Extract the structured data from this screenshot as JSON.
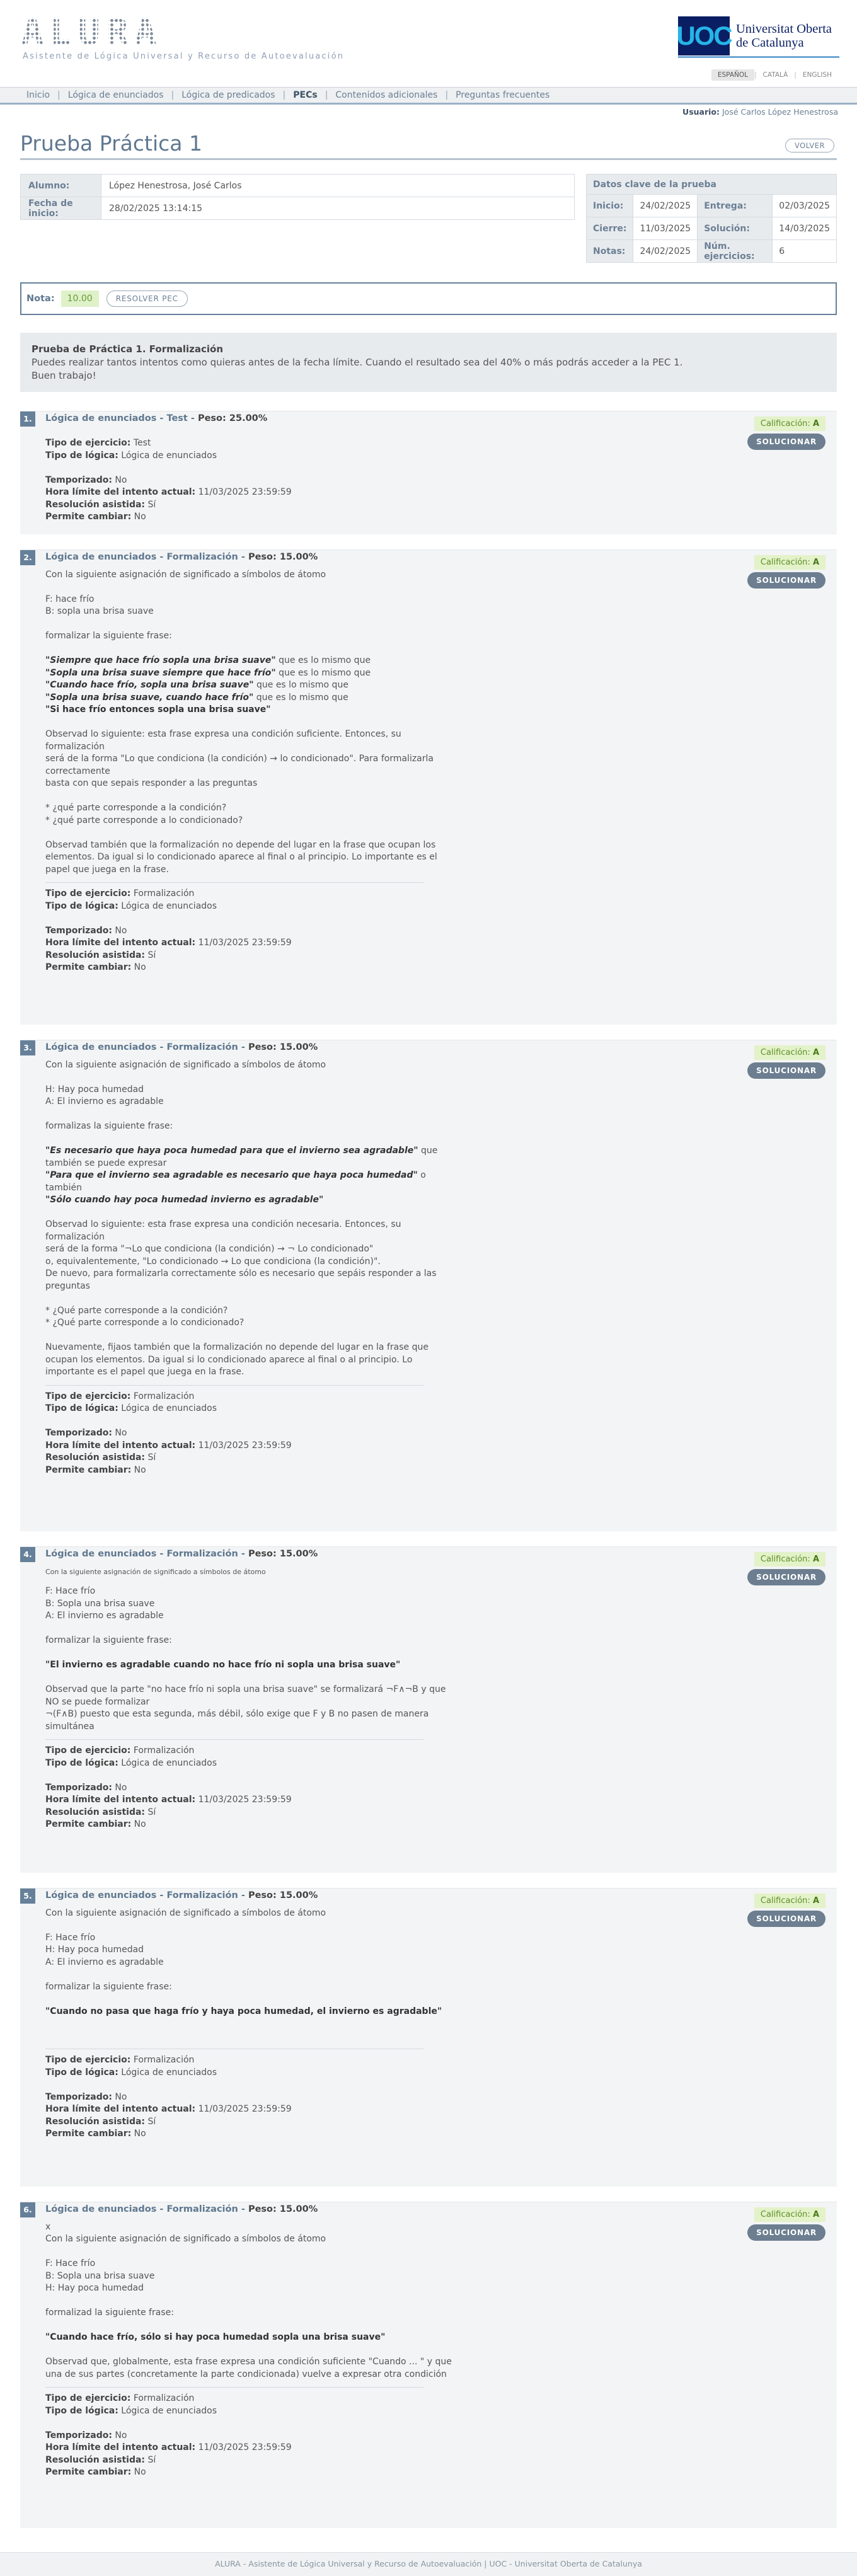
{
  "header": {
    "logo": "ALURA",
    "subtitle": "Asistente de Lógica Universal y Recurso de Autoevaluación",
    "uoc_mark": "UOC",
    "uoc_name_line1": "Universitat Oberta",
    "uoc_name_line2": "de Catalunya"
  },
  "lang": {
    "es": "ESPAÑOL",
    "ca": "CATALÀ",
    "en": "ENGLISH"
  },
  "nav": {
    "items": [
      "Inicio",
      "Lógica de enunciados",
      "Lógica de predicados",
      "PECs",
      "Contenidos adicionales",
      "Preguntas frecuentes"
    ],
    "active_index": 3
  },
  "user": {
    "label": "Usuario:",
    "name": "José Carlos López Henestrosa"
  },
  "page": {
    "title": "Prueba Práctica 1",
    "volver": "VOLVER"
  },
  "student": {
    "alumno_label": "Alumno:",
    "alumno": "López Henestrosa, José Carlos",
    "inicio_label": "Fecha de inicio:",
    "inicio": "28/02/2025 13:14:15"
  },
  "keyfacts": {
    "title": "Datos clave de la prueba",
    "inicio_label": "Inicio:",
    "inicio": "24/02/2025",
    "entrega_label": "Entrega:",
    "entrega": "02/03/2025",
    "cierre_label": "Cierre:",
    "cierre": "11/03/2025",
    "solucion_label": "Solución:",
    "solucion": "14/03/2025",
    "notas_label": "Notas:",
    "notas": "24/02/2025",
    "num_label": "Núm. ejercicios:",
    "num": "6"
  },
  "nota": {
    "label": "Nota:",
    "value": "10.00",
    "resolver": "RESOLVER PEC"
  },
  "intro": {
    "title": "Prueba de Práctica 1. Formalización",
    "line1": "Puedes realizar tantos intentos como quieras antes de la fecha límite. Cuando el resultado sea del 40% o más podrás acceder a la PEC 1.",
    "line2": "Buen trabajo!"
  },
  "common": {
    "calif_label": "Calificación:",
    "calif_value": "A",
    "solucionar": "SOLUCIONAR",
    "tipo_ejercicio_label": "Tipo de ejercicio:",
    "tipo_logica_label": "Tipo de lógica:",
    "temporizado_label": "Temporizado:",
    "hora_limite_label": "Hora límite del intento actual:",
    "resolucion_label": "Resolución asistida:",
    "permite_label": "Permite cambiar:",
    "logica": "Lógica de enunciados",
    "temporizado": "No",
    "hora_limite": "11/03/2025 23:59:59",
    "resolucion": "Sí",
    "permite": "No",
    "peso_label": "Peso:"
  },
  "q1": {
    "num": "1.",
    "title": "Lógica de enunciados - Test",
    "peso": "25.00%",
    "tipo": "Test"
  },
  "q2": {
    "num": "2.",
    "title": "Lógica de enunciados - Formalización",
    "peso": "15.00%",
    "tipo": "Formalización",
    "intro": "Con la siguiente asignación de significado a símbolos de átomo",
    "a1": "F: hace frío",
    "a2": "B: sopla una brisa suave",
    "formalizar": "formalizar la siguiente frase:",
    "s1": "\"Siempre que hace frío sopla una brisa suave\"",
    "s1r": "  que es lo mismo que",
    "s2": "\"Sopla una brisa suave siempre que hace frío\"",
    "s2r": " que es lo mismo que",
    "s3": "\"Cuando hace frío, sopla una brisa suave\"",
    "s3r": " que es lo mismo que",
    "s4": "\"Sopla una brisa suave, cuando hace frío\"",
    "s4r": " que es lo mismo que",
    "s5": "\"Si hace frío entonces sopla una brisa suave\"",
    "obs1": "Observad lo siguiente: esta frase expresa una condición suficiente. Entonces, su formalización",
    "obs2": "será de la forma \"Lo que condiciona (la condición) → lo condicionado\". Para formalizarla  correctamente",
    "obs3": "basta con que sepais responder a las preguntas",
    "p1": "* ¿qué parte corresponde a la condición?",
    "p2": "* ¿qué parte corresponde a lo condicionado?",
    "obs4": "Observad también que la formalización no depende del lugar en la frase que ocupan los elementos. Da igual si lo condicionado aparece al final o al principio. Lo importante es el papel que juega en la frase."
  },
  "q3": {
    "num": "3.",
    "title": "Lógica de enunciados - Formalización",
    "peso": "15.00%",
    "tipo": "Formalización",
    "intro": "Con la siguiente asignación de significado a símbolos de átomo",
    "a1": "H: Hay poca humedad",
    "a2": "A: El invierno es agradable",
    "formalizar": "formalizas la siguiente frase:",
    "s1": "\"Es necesario que haya poca humedad para que el invierno sea agradable\"",
    "s1r": " que",
    "s1r2": "también se puede expresar",
    "s2": "\"Para que el invierno sea agradable es necesario que haya poca humedad\"",
    "s2r": " o",
    "s2r2": "también",
    "s3": "\"Sólo cuando hay poca humedad invierno es agradable\"",
    "obs1": "Observad lo siguiente: esta frase expresa una condición necesaria. Entonces, su formalización",
    "obs2": "será de la forma \"¬Lo que condiciona (la condición) → ¬ Lo condicionado\"",
    "obs3": "o, equivalentemente, \"Lo condicionado → Lo que condiciona (la condición)\".",
    "obs4": "De nuevo, para formalizarla correctamente sólo es necesario que sepáis responder a las preguntas",
    "p1": "* ¿Qué parte corresponde a la condición?",
    "p2": "* ¿Qué parte corresponde a lo condicionado?",
    "obs5": "Nuevamente, fijaos también que la formalización no depende del lugar en la frase que ocupan los elementos. Da igual si lo condicionado aparece al final o al principio. Lo importante es el papel que juega en la frase."
  },
  "q4": {
    "num": "4.",
    "title": "Lógica de enunciados - Formalización",
    "peso": "15.00%",
    "tipo": "Formalización",
    "intro": "Con la siguiente asignación de significado a símbolos de átomo",
    "a1": "F: Hace frío",
    "a2": "B: Sopla una brisa suave",
    "a3": "A: El invierno es agradable",
    "formalizar": "formalizar la siguiente frase:",
    "s1": "\"El invierno es agradable cuando no hace frío ni sopla una brisa suave\"",
    "obs1": "Observad que la parte \"no hace frío ni sopla una brisa suave\" se formalizará ¬F∧¬B y que NO se puede formalizar",
    "obs2": "¬(F∧B) puesto que esta segunda, más débil, sólo exige que F y B no pasen de manera simultánea"
  },
  "q5": {
    "num": "5.",
    "title": "Lógica de enunciados - Formalización",
    "peso": "15.00%",
    "tipo": "Formalización",
    "intro": "Con la siguiente asignación de significado a símbolos de átomo",
    "a1": "F: Hace frío",
    "a2": "H: Hay poca humedad",
    "a3": "A: El invierno es agradable",
    "formalizar": "formalizar la siguiente frase:",
    "s1": "\"Cuando no pasa que haga frío y haya poca humedad, el invierno es agradable\""
  },
  "q6": {
    "num": "6.",
    "title": "Lógica de enunciados - Formalización",
    "peso": "15.00%",
    "tipo": "Formalización",
    "x": "x",
    "intro": "Con la siguiente asignación de significado a símbolos de átomo",
    "a1": "F: Hace frío",
    "a2": "B: Sopla una brisa suave",
    "a3": "H: Hay poca humedad",
    "formalizar": "formalizad la siguiente frase:",
    "s1": "\"Cuando hace frío, sólo si hay poca humedad sopla una brisa suave\"",
    "obs1": "Observad que, globalmente, esta frase expresa una condición suficiente \"Cuando ... \" y que una de sus partes (concretamente la parte condicionada) vuelve a expresar otra condición"
  },
  "footer": {
    "text": "ALURA - Asistente de Lógica Universal y Recurso de Autoevaluación | UOC - Universitat Oberta de Catalunya"
  }
}
